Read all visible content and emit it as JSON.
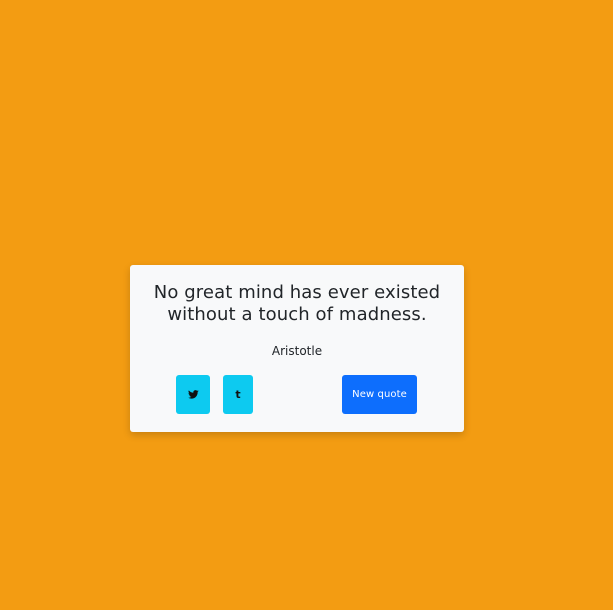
{
  "page": {
    "background_color": "#f39c12"
  },
  "quote_card": {
    "quote_text": "No great mind has ever existed without a touch of madness.",
    "author": "Aristotle",
    "buttons": {
      "twitter_icon": "twitter-icon",
      "tumblr_icon": "tumblr-icon",
      "tumblr_glyph": "t",
      "new_quote_label": "New quote"
    },
    "colors": {
      "card_background": "#f8f9fa",
      "social_button": "#0dcaf0",
      "primary_button": "#0d6efd",
      "text": "#212529"
    }
  }
}
